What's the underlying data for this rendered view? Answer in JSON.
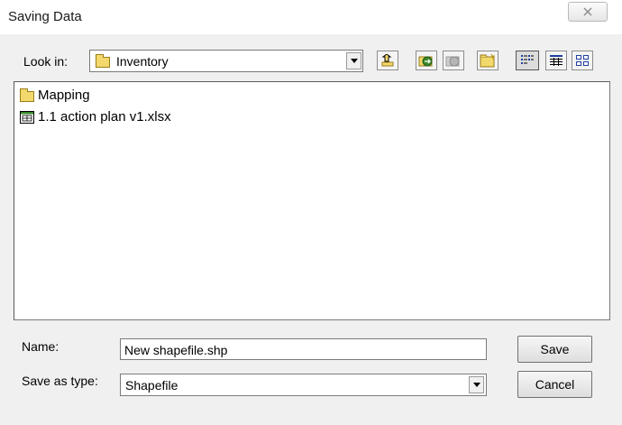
{
  "window": {
    "title": "Saving Data",
    "close_icon": "close-icon"
  },
  "lookin": {
    "label": "Look in:",
    "value": "Inventory",
    "icons": [
      "up-one-level-icon",
      "connect-folder-icon",
      "disconnect-folder-icon",
      "new-folder-icon",
      "list-view-icon",
      "details-view-icon",
      "thumbnails-view-icon"
    ]
  },
  "files": [
    {
      "name": "Mapping",
      "icon": "folder-icon"
    },
    {
      "name": "1.1 action plan v1.xlsx",
      "icon": "spreadsheet-icon"
    }
  ],
  "name_field": {
    "label": "Name:",
    "value": "New shapefile.shp"
  },
  "type_field": {
    "label": "Save as type:",
    "value": "Shapefile"
  },
  "buttons": {
    "save": "Save",
    "cancel": "Cancel"
  },
  "colors": {
    "folder": "#f3d96b",
    "accent_green": "#3a8a2a"
  }
}
